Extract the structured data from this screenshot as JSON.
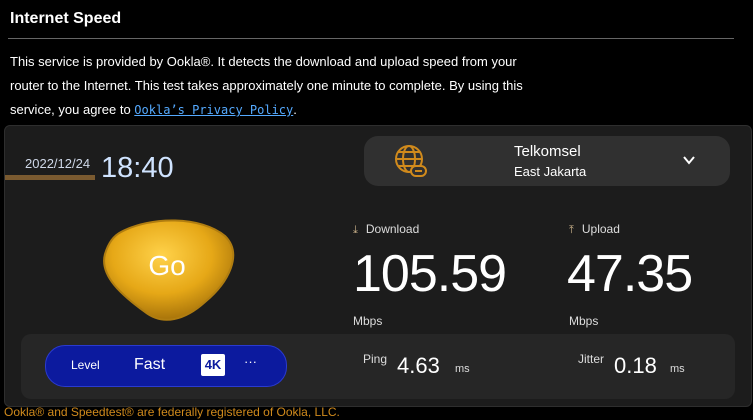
{
  "header": {
    "title": "Internet Speed",
    "description_prefix": "This service is provided by Ookla®. It detects the download and upload speed from your router to the Internet. This test takes approximately one minute to complete. By using this service, you agree to ",
    "privacy_link": "Ookla’s Privacy Policy",
    "description_suffix": "."
  },
  "test": {
    "date": "2022/12/24",
    "time": "18:40",
    "server": {
      "isp": "Telkomsel",
      "location": "East Jakarta"
    },
    "go_label": "Go",
    "download": {
      "label": "Download",
      "value": "105.59",
      "unit": "Mbps"
    },
    "upload": {
      "label": "Upload",
      "value": "47.35",
      "unit": "Mbps"
    },
    "level": {
      "label": "Level",
      "value": "Fast",
      "badge": "4K",
      "more": "···"
    },
    "ping": {
      "label": "Ping",
      "value": "4.63",
      "unit": "ms"
    },
    "jitter": {
      "label": "Jitter",
      "value": "0.18",
      "unit": "ms"
    }
  },
  "footer": "Ookla® and Speedtest® are federally registered of Ookla, LLC.",
  "colors": {
    "accent_gold": "#e6a817",
    "level_pill": "#0c1a9e",
    "link": "#55aaff",
    "footer_text": "#d08a1c"
  },
  "icons": {
    "server": "globe-icon",
    "dropdown": "chevron-down-icon",
    "download": "arrow-down-icon",
    "upload": "arrow-up-icon"
  }
}
